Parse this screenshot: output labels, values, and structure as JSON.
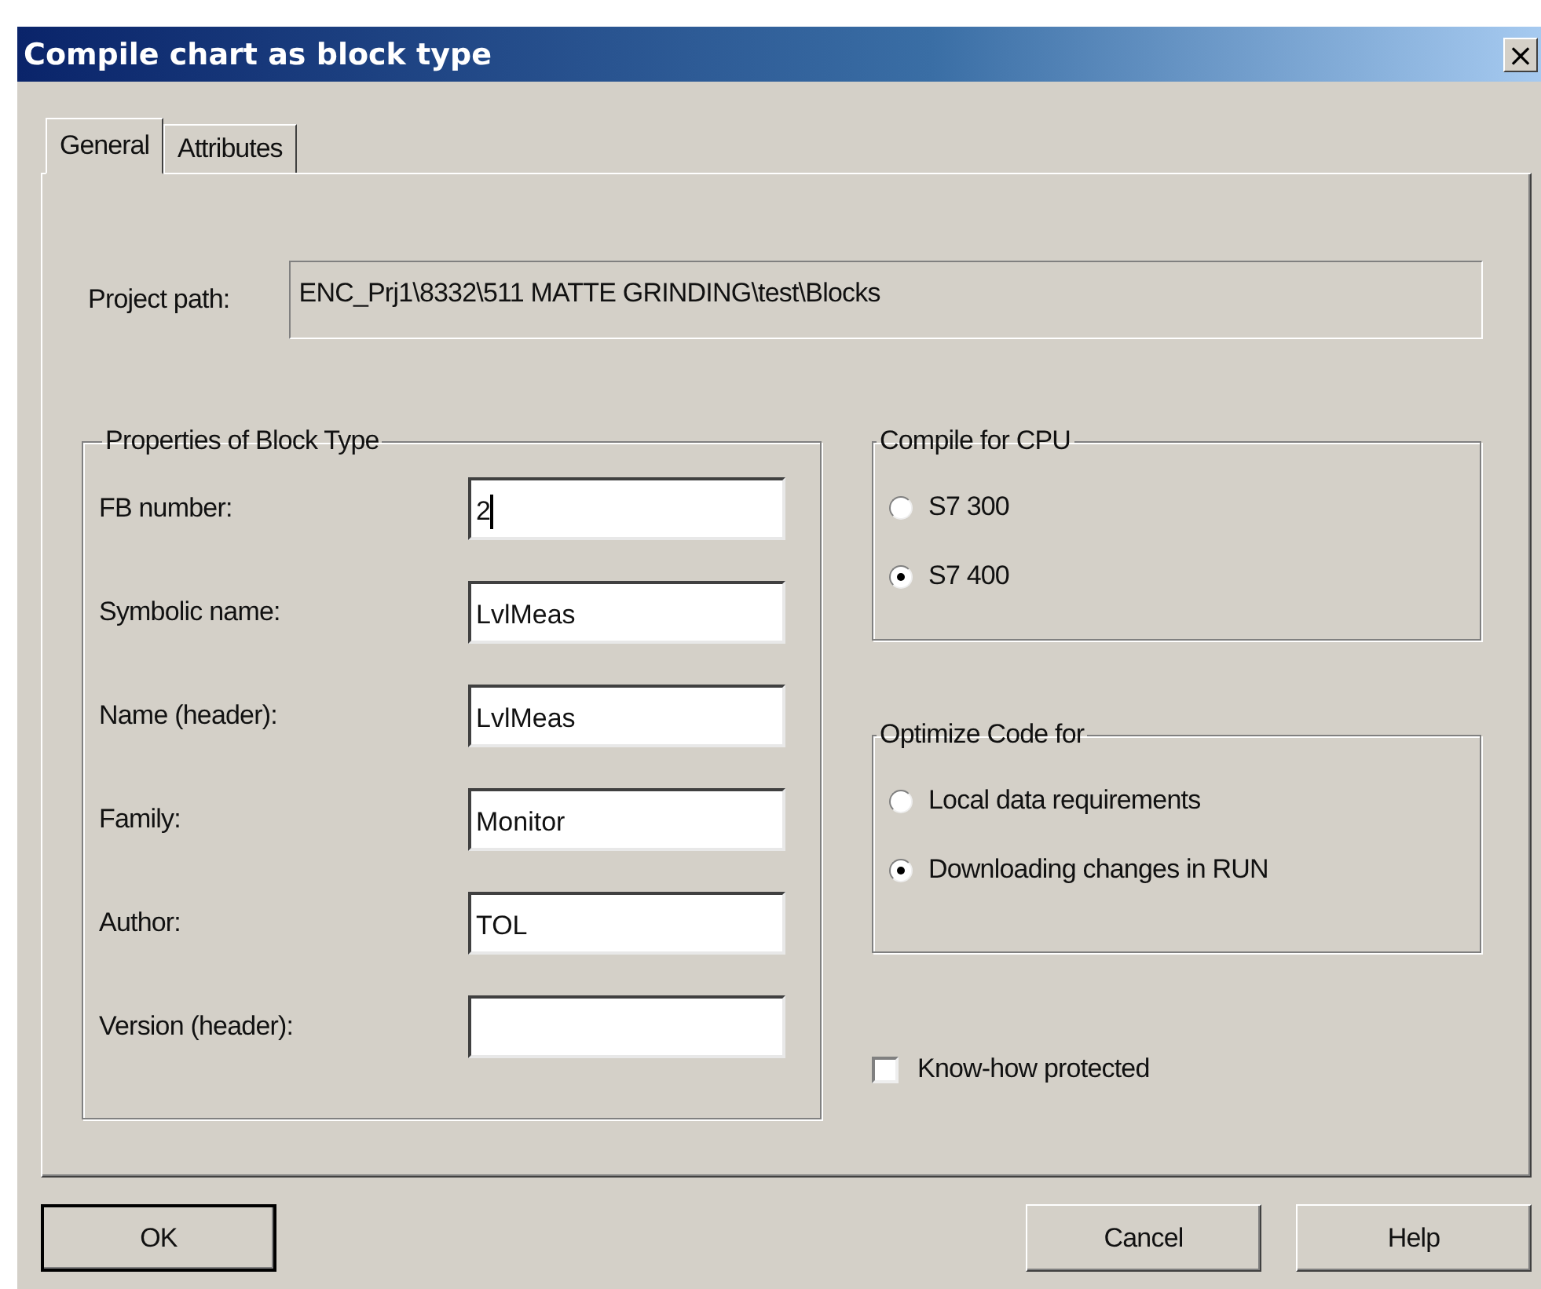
{
  "window": {
    "title": "Compile chart as block type",
    "close": "×"
  },
  "tabs": [
    {
      "label": "General",
      "selected": true
    },
    {
      "label": "Attributes",
      "selected": false
    }
  ],
  "project_path": {
    "label": "Project path:",
    "value": "ENC_Prj1\\8332\\511 MATTE GRINDING\\test\\Blocks"
  },
  "properties": {
    "title": "Properties of Block Type",
    "fields": [
      {
        "label": "FB number:",
        "value": "2",
        "focused": true
      },
      {
        "label": "Symbolic name:",
        "value": "LvlMeas",
        "focused": false
      },
      {
        "label": "Name (header):",
        "value": "LvlMeas",
        "focused": false
      },
      {
        "label": "Family:",
        "value": "Monitor",
        "focused": false
      },
      {
        "label": "Author:",
        "value": "TOL",
        "focused": false
      },
      {
        "label": "Version (header):",
        "focused": false
      }
    ]
  },
  "compile_for_cpu": {
    "title": "Compile for CPU",
    "options": [
      {
        "label": "S7 300",
        "selected": false
      },
      {
        "label": "S7 400",
        "selected": true
      }
    ]
  },
  "optimize_code": {
    "title": "Optimize Code for",
    "options": [
      {
        "label": "Local data requirements",
        "selected": false
      },
      {
        "label": "Downloading changes in RUN",
        "selected": true
      }
    ]
  },
  "know_how_protected": {
    "label": "Know-how protected",
    "checked": false
  },
  "buttons": [
    {
      "label": "OK",
      "default": true
    },
    {
      "label": "Cancel",
      "default": false
    },
    {
      "label": "Help",
      "default": false
    }
  ]
}
